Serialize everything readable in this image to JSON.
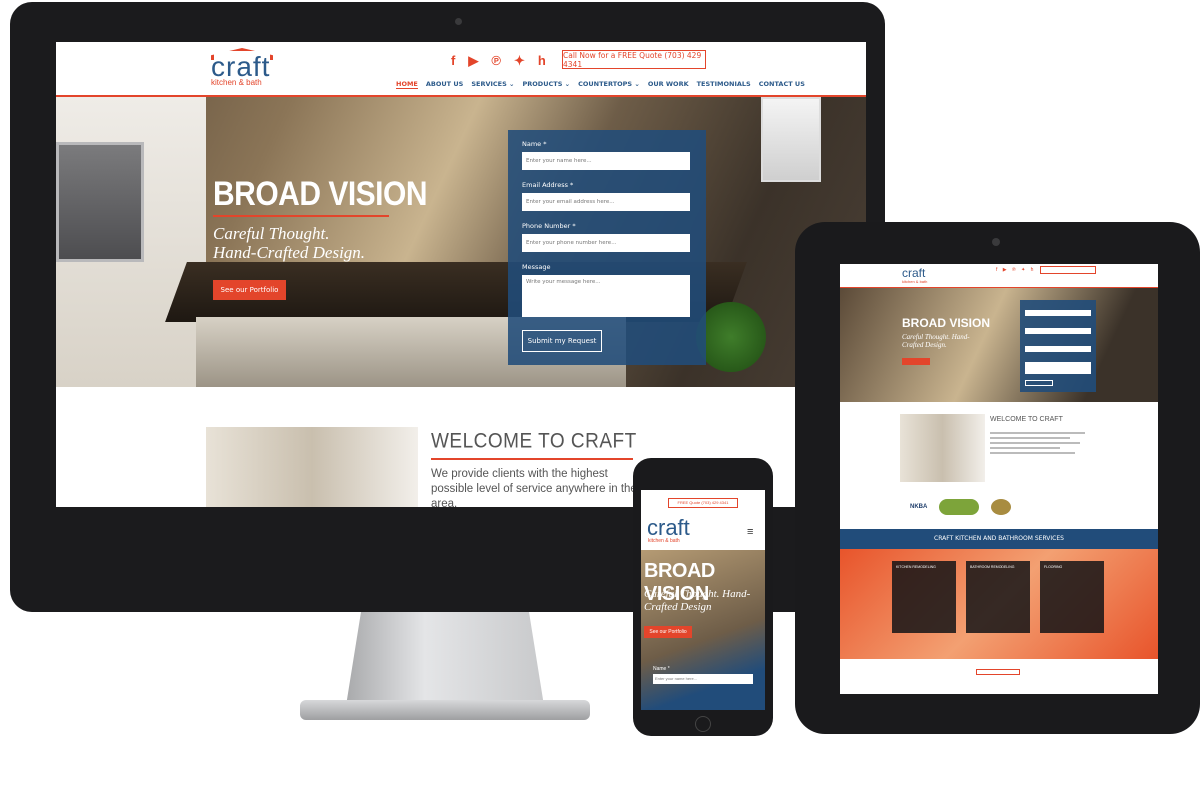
{
  "desktop": {
    "logo": {
      "word": "craft",
      "sub": "kitchen & bath"
    },
    "social_icons": [
      "facebook-icon",
      "youtube-icon",
      "pinterest-icon",
      "twitter-icon",
      "houzz-icon"
    ],
    "social_glyphs": [
      "f",
      "▶",
      "℗",
      "✦",
      "h"
    ],
    "cta": "Call Now for a FREE Quote (703) 429 4341",
    "nav": [
      "HOME",
      "ABOUT US",
      "SERVICES ⌄",
      "PRODUCTS ⌄",
      "COUNTERTOPS ⌄",
      "OUR WORK",
      "TESTIMONIALS",
      "CONTACT US"
    ],
    "hero": {
      "title": "BROAD VISION",
      "subtitle_line1": "Careful Thought.",
      "subtitle_line2": "Hand-Crafted Design.",
      "button": "See our Portfolio"
    },
    "form": {
      "name_label": "Name *",
      "name_placeholder": "Enter your name here...",
      "email_label": "Email Address *",
      "email_placeholder": "Enter your email address here...",
      "phone_label": "Phone Number *",
      "phone_placeholder": "Enter your phone number here...",
      "message_label": "Message",
      "message_placeholder": "Write your message here...",
      "submit": "Submit my Request"
    },
    "welcome": {
      "title": "WELCOME TO CRAFT",
      "text": "We provide clients with the highest possible level of service anywhere in the area."
    }
  },
  "tablet": {
    "logo": "craft",
    "hero_title": "BROAD VISION",
    "hero_subtitle": "Careful Thought. Hand-Crafted Design.",
    "welcome_title": "WELCOME TO CRAFT",
    "logos": [
      "NKBA"
    ],
    "services_bar": "CRAFT KITCHEN AND BATHROOM SERVICES",
    "service_cards": [
      "KITCHEN REMODELING",
      "BATHROOM REMODELING",
      "FLOORING"
    ]
  },
  "phone": {
    "cta": "FREE Quote (703) 429 4341",
    "logo": "craft",
    "logo_sub": "kitchen & bath",
    "menu_icon": "≡",
    "hero_title": "BROAD VISION",
    "hero_subtitle": "Careful Thought. Hand-Crafted Design",
    "button": "See our Portfolio",
    "form_label": "Name *",
    "form_placeholder": "Enter your name here..."
  },
  "colors": {
    "accent": "#e3452b",
    "brand_blue": "#2c5a8a",
    "form_blue": "#214c7a"
  }
}
